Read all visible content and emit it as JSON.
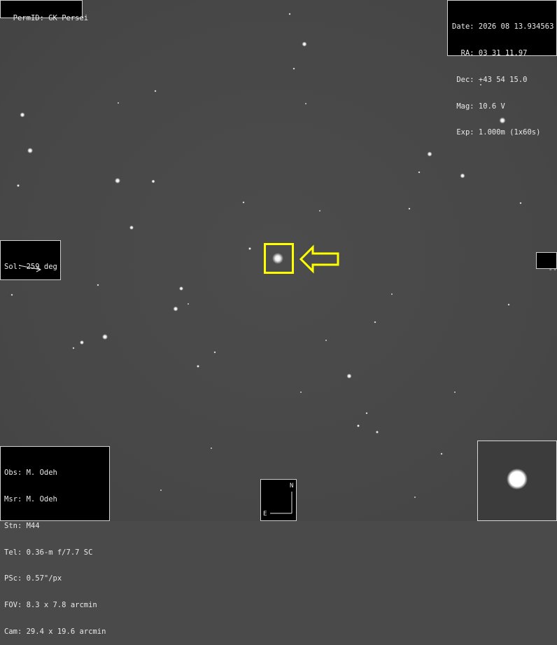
{
  "header": {
    "permid": "PermID: GK Persei"
  },
  "info": {
    "date": "Date: 2026 08 13.934563",
    "ra": "  RA: 03 31 11.97",
    "dec": " Dec: +43 54 15.0",
    "mag": " Mag: 10.6 V",
    "exp": " Exp: 1.000m (1x60s)"
  },
  "sol": {
    "label": "Sol: 259 deg"
  },
  "side": {
    "dash": "---"
  },
  "observer": {
    "obs": "Obs: M. Odeh",
    "msr": "Msr: M. Odeh",
    "stn": "Stn: M44",
    "tel": "Tel: 0.36-m f/7.7 SC",
    "psc": "PSc: 0.57\"/px",
    "fov": "FOV: 8.3 x 7.8 arcmin",
    "cam": "Cam: 29.4 x 19.6 arcmin"
  },
  "compass": {
    "north": "N",
    "east": "E"
  },
  "colors": {
    "highlight": "#ffff00",
    "panel_bg": "#000000",
    "sky": "#4a4a4a"
  }
}
